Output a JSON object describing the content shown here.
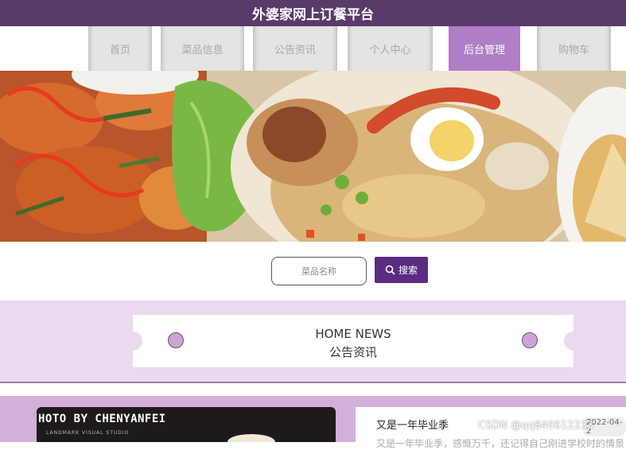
{
  "app": {
    "title": "外婆家网上订餐平台"
  },
  "nav": {
    "items": [
      {
        "label": "首页"
      },
      {
        "label": "菜品信息"
      },
      {
        "label": "公告资讯"
      },
      {
        "label": "个人中心"
      },
      {
        "label": "后台管理",
        "active": true
      },
      {
        "label": "购物车"
      }
    ]
  },
  "search": {
    "placeholder": "菜品名称",
    "button_label": "搜索"
  },
  "news_header": {
    "title_en": "HOME NEWS",
    "title_cn": "公告资讯"
  },
  "featured": {
    "photo_text": "HOTO BY CHENYANFEI",
    "photo_subtext": "LANDMARK VISUAL STUDIO",
    "article_title": "又是一年毕业季",
    "article_date": "2022-04-2",
    "article_snippet": "又是一年毕业季，感慨万千，还记得自己刚进学校时的情景"
  },
  "watermark": "CSDN @qq840612233",
  "colors": {
    "topbar": "#5a3a6a",
    "nav_active": "#b07ec6",
    "search_button": "#5a2d82",
    "news_band": "#ead9ef",
    "lower_band": "#d2b0da"
  },
  "icons": {
    "search": "magnifier-icon"
  }
}
